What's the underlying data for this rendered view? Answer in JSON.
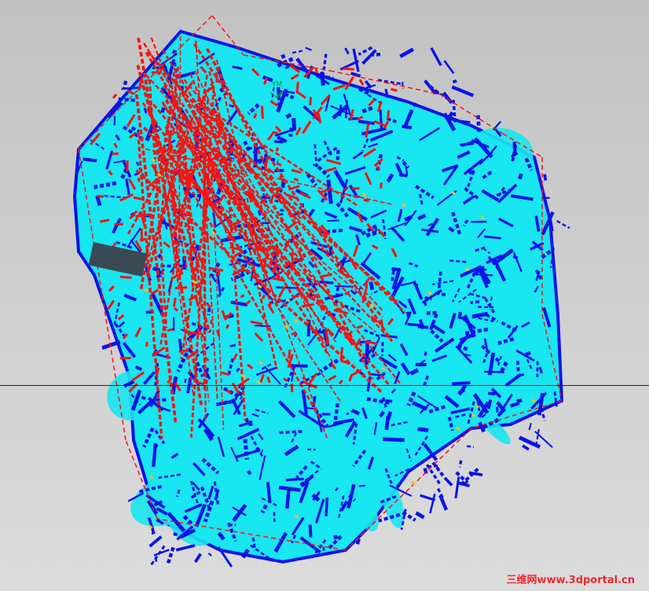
{
  "viewport": {
    "axis_label": "YM",
    "watermark": "三维网www.3dportal.cn"
  },
  "colors": {
    "background_top": "#c2c2c2",
    "background_bottom": "#dcdcdc",
    "toolpath_cut": "#0a14e6",
    "toolpath_rapid": "#ff1010",
    "surface_fill": "#18e6f0",
    "highlight": "#f0c020",
    "axis": "#1a8f1a"
  },
  "icons": {
    "axis_triad": "axis-triad-icon"
  }
}
